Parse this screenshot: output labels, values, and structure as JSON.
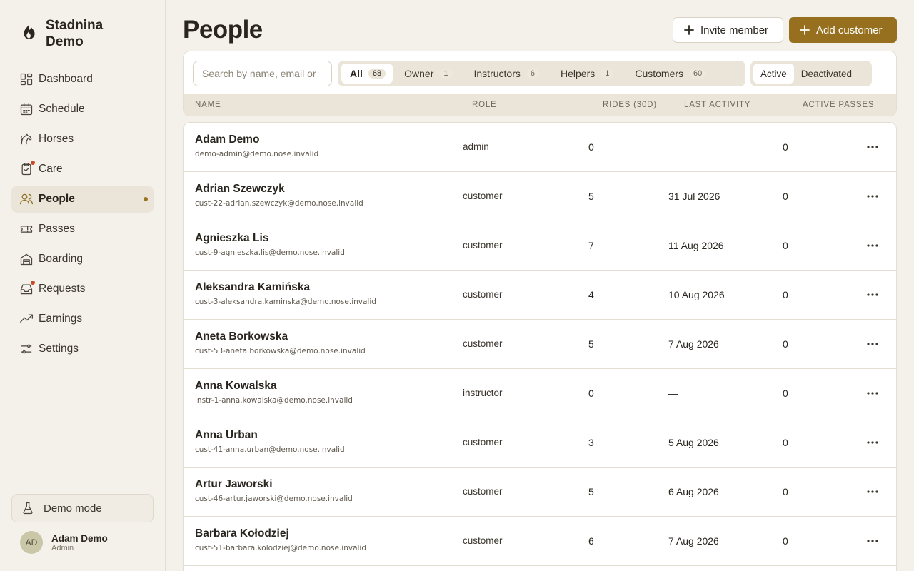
{
  "brand": {
    "name": "Stadnina Demo"
  },
  "sidebar": {
    "items": [
      {
        "label": "Dashboard",
        "icon": "dashboard-icon"
      },
      {
        "label": "Schedule",
        "icon": "calendar-icon"
      },
      {
        "label": "Horses",
        "icon": "horse-icon"
      },
      {
        "label": "Care",
        "icon": "clipboard-icon",
        "badge": true
      },
      {
        "label": "People",
        "icon": "users-icon",
        "active": true
      },
      {
        "label": "Passes",
        "icon": "ticket-icon"
      },
      {
        "label": "Boarding",
        "icon": "stable-icon"
      },
      {
        "label": "Requests",
        "icon": "inbox-icon",
        "badge": true
      },
      {
        "label": "Earnings",
        "icon": "trending-up-icon"
      },
      {
        "label": "Settings",
        "icon": "sliders-icon"
      }
    ],
    "demo_mode": "Demo mode",
    "user": {
      "initials": "AD",
      "name": "Adam Demo",
      "role": "Admin"
    }
  },
  "header": {
    "title": "People",
    "invite_label": "Invite member",
    "add_label": "Add customer"
  },
  "search": {
    "placeholder": "Search by name, email or"
  },
  "filters": [
    {
      "label": "All",
      "count": "68",
      "active": true
    },
    {
      "label": "Owner",
      "count": "1"
    },
    {
      "label": "Instructors",
      "count": "6"
    },
    {
      "label": "Helpers",
      "count": "1"
    },
    {
      "label": "Customers",
      "count": "60"
    }
  ],
  "status": {
    "active": "Active",
    "deactivated": "Deactivated"
  },
  "columns": {
    "name": "NAME",
    "role": "ROLE",
    "rides": "RIDES (30D)",
    "last": "LAST ACTIVITY",
    "passes": "ACTIVE PASSES"
  },
  "rows": [
    {
      "name": "Adam Demo",
      "email": "demo-admin@demo.nose.invalid",
      "role": "admin",
      "rides": "0",
      "last": "—",
      "passes": "0"
    },
    {
      "name": "Adrian Szewczyk",
      "email": "cust-22-adrian.szewczyk@demo.nose.invalid",
      "role": "customer",
      "rides": "5",
      "last": "31 Jul 2026",
      "passes": "0"
    },
    {
      "name": "Agnieszka Lis",
      "email": "cust-9-agnieszka.lis@demo.nose.invalid",
      "role": "customer",
      "rides": "7",
      "last": "11 Aug 2026",
      "passes": "0"
    },
    {
      "name": "Aleksandra Kamińska",
      "email": "cust-3-aleksandra.kaminska@demo.nose.invalid",
      "role": "customer",
      "rides": "4",
      "last": "10 Aug 2026",
      "passes": "0"
    },
    {
      "name": "Aneta Borkowska",
      "email": "cust-53-aneta.borkowska@demo.nose.invalid",
      "role": "customer",
      "rides": "5",
      "last": "7 Aug 2026",
      "passes": "0"
    },
    {
      "name": "Anna Kowalska",
      "email": "instr-1-anna.kowalska@demo.nose.invalid",
      "role": "instructor",
      "rides": "0",
      "last": "—",
      "passes": "0"
    },
    {
      "name": "Anna Urban",
      "email": "cust-41-anna.urban@demo.nose.invalid",
      "role": "customer",
      "rides": "3",
      "last": "5 Aug 2026",
      "passes": "0"
    },
    {
      "name": "Artur Jaworski",
      "email": "cust-46-artur.jaworski@demo.nose.invalid",
      "role": "customer",
      "rides": "5",
      "last": "6 Aug 2026",
      "passes": "0"
    },
    {
      "name": "Barbara Kołodziej",
      "email": "cust-51-barbara.kolodziej@demo.nose.invalid",
      "role": "customer",
      "rides": "6",
      "last": "7 Aug 2026",
      "passes": "0"
    }
  ],
  "colors": {
    "accent": "#96701f",
    "background": "#f4f1eb",
    "badge": "#c94a2a"
  }
}
